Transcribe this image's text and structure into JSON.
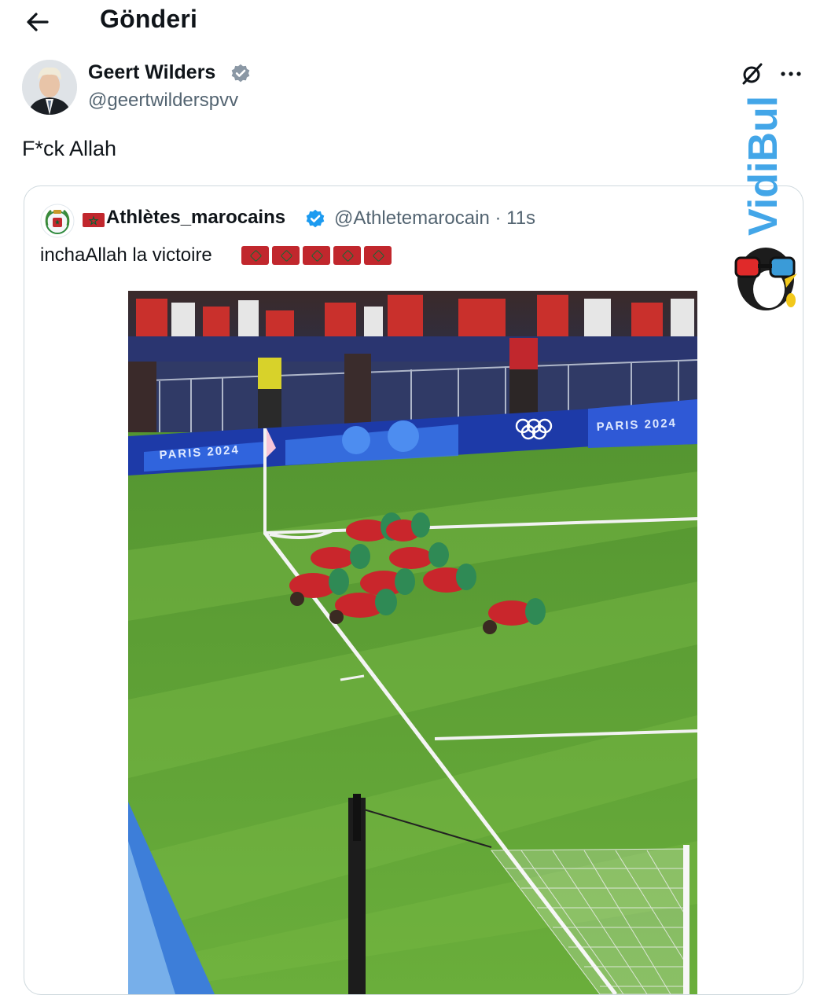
{
  "header": {
    "title": "Gönderi",
    "back_icon": "arrow-left-icon"
  },
  "post": {
    "author_name": "Geert Wilders",
    "author_handle": "@geertwilderspvv",
    "verified_icon": "verified-badge-icon",
    "text": "F*ck Allah"
  },
  "quoted_post": {
    "author_name": "Athlètes_marocains",
    "author_handle": "@Athletemarocain",
    "time": "11s",
    "text": "inchaAllah la victoire",
    "flag_count": 5,
    "media_signage_1": "PARIS 2024",
    "media_signage_2": "PARIS 2024"
  },
  "watermark": {
    "text": "VidiBul"
  },
  "colors": {
    "verified": "#1d9bf0",
    "secondary_text": "#536471",
    "border": "#cfd9de",
    "morocco_red": "#c1272d",
    "morocco_green": "#006233",
    "watermark_blue": "#43a6e8"
  }
}
